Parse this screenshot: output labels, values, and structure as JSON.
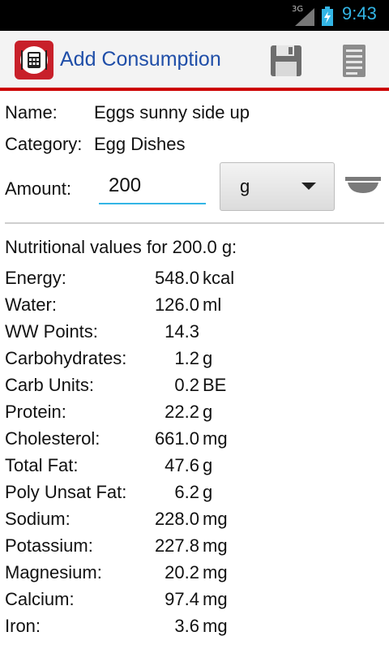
{
  "status": {
    "network": "3G",
    "time": "9:43"
  },
  "actionbar": {
    "title": "Add Consumption",
    "save_icon": "floppy-save-icon",
    "details_icon": "document-list-icon",
    "app_icon": "calculator-cutlery-icon"
  },
  "form": {
    "name_label": "Name:",
    "name_value": "Eggs sunny side up",
    "category_label": "Category:",
    "category_value": "Egg Dishes",
    "amount_label": "Amount:",
    "amount_value": "200",
    "unit_value": "g"
  },
  "nutrition": {
    "title": "Nutritional values for 200.0 g:",
    "rows": [
      {
        "label": "Energy:",
        "value": "548.0",
        "unit": "kcal"
      },
      {
        "label": "Water:",
        "value": "126.0",
        "unit": "ml"
      },
      {
        "label": "WW Points:",
        "value": "14.3",
        "unit": ""
      },
      {
        "label": "Carbohydrates:",
        "value": "1.2",
        "unit": "g"
      },
      {
        "label": "Carb Units:",
        "value": "0.2",
        "unit": "BE"
      },
      {
        "label": "Protein:",
        "value": "22.2",
        "unit": "g"
      },
      {
        "label": "Cholesterol:",
        "value": "661.0",
        "unit": "mg"
      },
      {
        "label": "Total Fat:",
        "value": "47.6",
        "unit": "g"
      },
      {
        "label": "Poly Unsat Fat:",
        "value": "6.2",
        "unit": "g"
      },
      {
        "label": "Sodium:",
        "value": "228.0",
        "unit": "mg"
      },
      {
        "label": "Potassium:",
        "value": "227.8",
        "unit": "mg"
      },
      {
        "label": "Magnesium:",
        "value": "20.2",
        "unit": "mg"
      },
      {
        "label": "Calcium:",
        "value": "97.4",
        "unit": "mg"
      },
      {
        "label": "Iron:",
        "value": "3.6",
        "unit": "mg"
      }
    ]
  }
}
